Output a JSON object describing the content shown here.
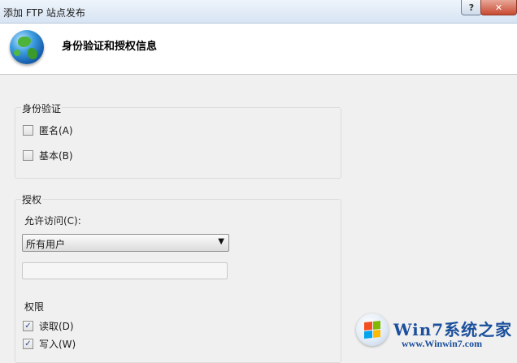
{
  "window": {
    "title": "添加 FTP 站点发布",
    "help_label": "?",
    "close_label": "✕"
  },
  "header": {
    "icon": "globe-icon",
    "title": "身份验证和授权信息"
  },
  "authentication": {
    "legend": "身份验证",
    "options": [
      {
        "label": "匿名(A)",
        "checked": false
      },
      {
        "label": "基本(B)",
        "checked": false
      }
    ]
  },
  "authorization": {
    "legend": "授权",
    "access_label": "允许访问(C):",
    "access_selected": "所有用户",
    "access_value_text": "",
    "permissions_label": "权限",
    "permissions": [
      {
        "label": "读取(D)",
        "checked": true
      },
      {
        "label": "写入(W)",
        "checked": true
      }
    ]
  },
  "watermark": {
    "title": "Win7系统之家",
    "url": "www.Winwin7.com"
  }
}
